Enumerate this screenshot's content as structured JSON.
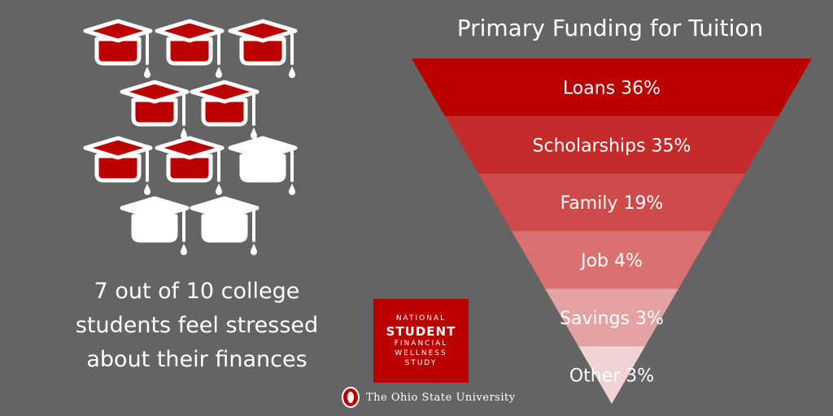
{
  "stat": {
    "lines": [
      "7 out of 10 college",
      "students feel stressed",
      "about their finances"
    ],
    "stressed_count": 7,
    "total_count": 10
  },
  "colors": {
    "background": "#646464",
    "stressed_cap": "#bb0000",
    "unstressed_cap": "#ffffff",
    "outline": "#ffffff"
  },
  "chart_data": {
    "type": "funnel",
    "title": "Primary Funding for Tuition",
    "categories": [
      "Loans",
      "Scholarships",
      "Family",
      "Job",
      "Savings",
      "Other"
    ],
    "values": [
      36,
      35,
      19,
      4,
      3,
      3
    ],
    "unit": "%",
    "colors": [
      "#bb0000",
      "#c42b2b",
      "#cf4a4a",
      "#da7070",
      "#e5a2a2",
      "#f2d3d3"
    ]
  },
  "logo": {
    "line1": "NATIONAL",
    "line2": "STUDENT",
    "line3": "FINANCIAL",
    "line4": "WELLNESS",
    "line5": "STUDY"
  },
  "university": "The Ohio State University"
}
